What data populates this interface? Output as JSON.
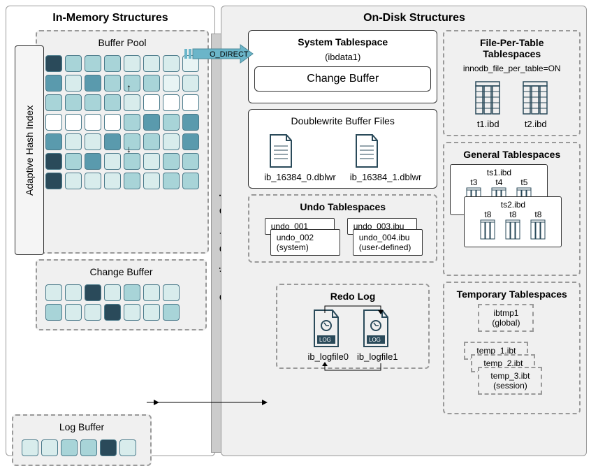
{
  "sections": {
    "in_memory": "In-Memory Structures",
    "on_disk": "On-Disk Structures"
  },
  "adaptive_hash": "Adaptive Hash Index",
  "buffer_pool": {
    "title": "Buffer Pool"
  },
  "change_buffer_mem": {
    "title": "Change Buffer"
  },
  "log_buffer": {
    "title": "Log Buffer"
  },
  "os_cache": "Operating System Cache",
  "o_direct": "O_DIRECT",
  "system_tablespace": {
    "title": "System Tablespace",
    "subtitle": "(ibdata1)",
    "change_buffer": "Change Buffer"
  },
  "file_per_table": {
    "title": "File-Per-Table Tablespaces",
    "config": "innodb_file_per_table=ON",
    "files": [
      "t1.ibd",
      "t2.ibd"
    ]
  },
  "doublewrite": {
    "title": "Doublewrite Buffer Files",
    "files": [
      "ib_16384_0.dblwr",
      "ib_16384_1.dblwr"
    ]
  },
  "general_tablespaces": {
    "title": "General Tablespaces",
    "ts1": {
      "name": "ts1.ibd",
      "tables": [
        "t3",
        "t4",
        "t5"
      ]
    },
    "ts2": {
      "name": "ts2.ibd",
      "tables": [
        "t8",
        "t8",
        "t8"
      ]
    }
  },
  "undo": {
    "title": "Undo Tablespaces",
    "system": [
      "undo_001",
      "undo_002 (system)"
    ],
    "user": [
      "undo_003.ibu",
      "undo_004.ibu (user-defined)"
    ]
  },
  "redo": {
    "title": "Redo Log",
    "files": [
      "ib_logfile0",
      "ib_logfile1"
    ]
  },
  "temp": {
    "title": "Temporary Tablespaces",
    "global": "ibtmp1 (global)",
    "sessions": [
      "temp_1.ibt",
      "temp_2.ibt",
      "temp_3.ibt (session)"
    ]
  }
}
